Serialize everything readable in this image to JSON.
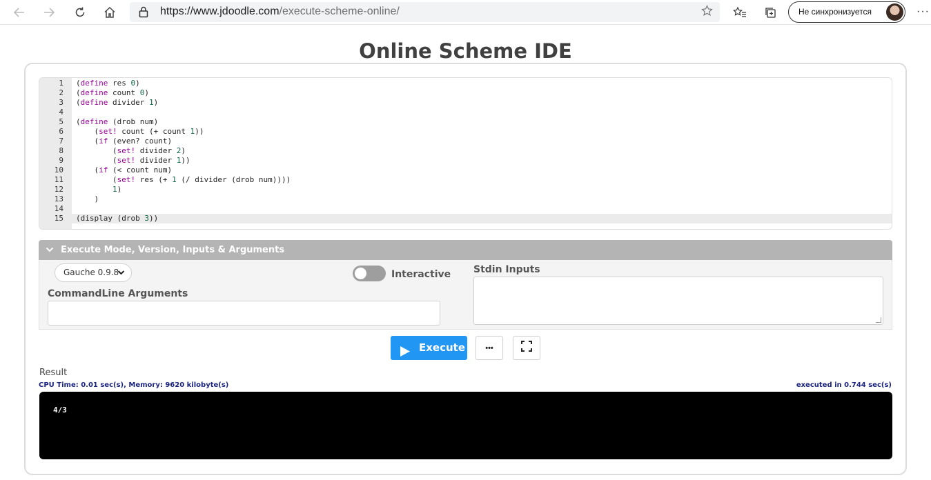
{
  "browser": {
    "url_host": "https://www.jdoodle.com",
    "url_path": "/execute-scheme-online/",
    "sync_label": "Не синхронизуется",
    "more_label": "···"
  },
  "page": {
    "title": "Online Scheme IDE"
  },
  "editor": {
    "line_numbers": [
      "1",
      "2",
      "3",
      "4",
      "5",
      "6",
      "7",
      "8",
      "9",
      "10",
      "11",
      "12",
      "13",
      "14",
      "15"
    ],
    "active_line": 15
  },
  "panel": {
    "header": "Execute Mode, Version, Inputs & Arguments",
    "version": "Gauche 0.9.8",
    "interactive_label": "Interactive",
    "interactive_on": false,
    "cmdline_label": "CommandLine Arguments",
    "cmdline_value": "",
    "stdin_label": "Stdin Inputs",
    "stdin_value": ""
  },
  "actions": {
    "execute_label": "Execute",
    "more_label": "•••"
  },
  "result": {
    "label": "Result",
    "stats": "CPU Time: 0.01 sec(s), Memory: 9620 kilobyte(s)",
    "exec_time": "executed in 0.744 sec(s)",
    "output": "4/3"
  },
  "colors": {
    "accent": "#2196f3",
    "panel_header": "#b4b4b4",
    "keyword": "#990099",
    "number": "#116644",
    "stats": "#1a237e"
  }
}
